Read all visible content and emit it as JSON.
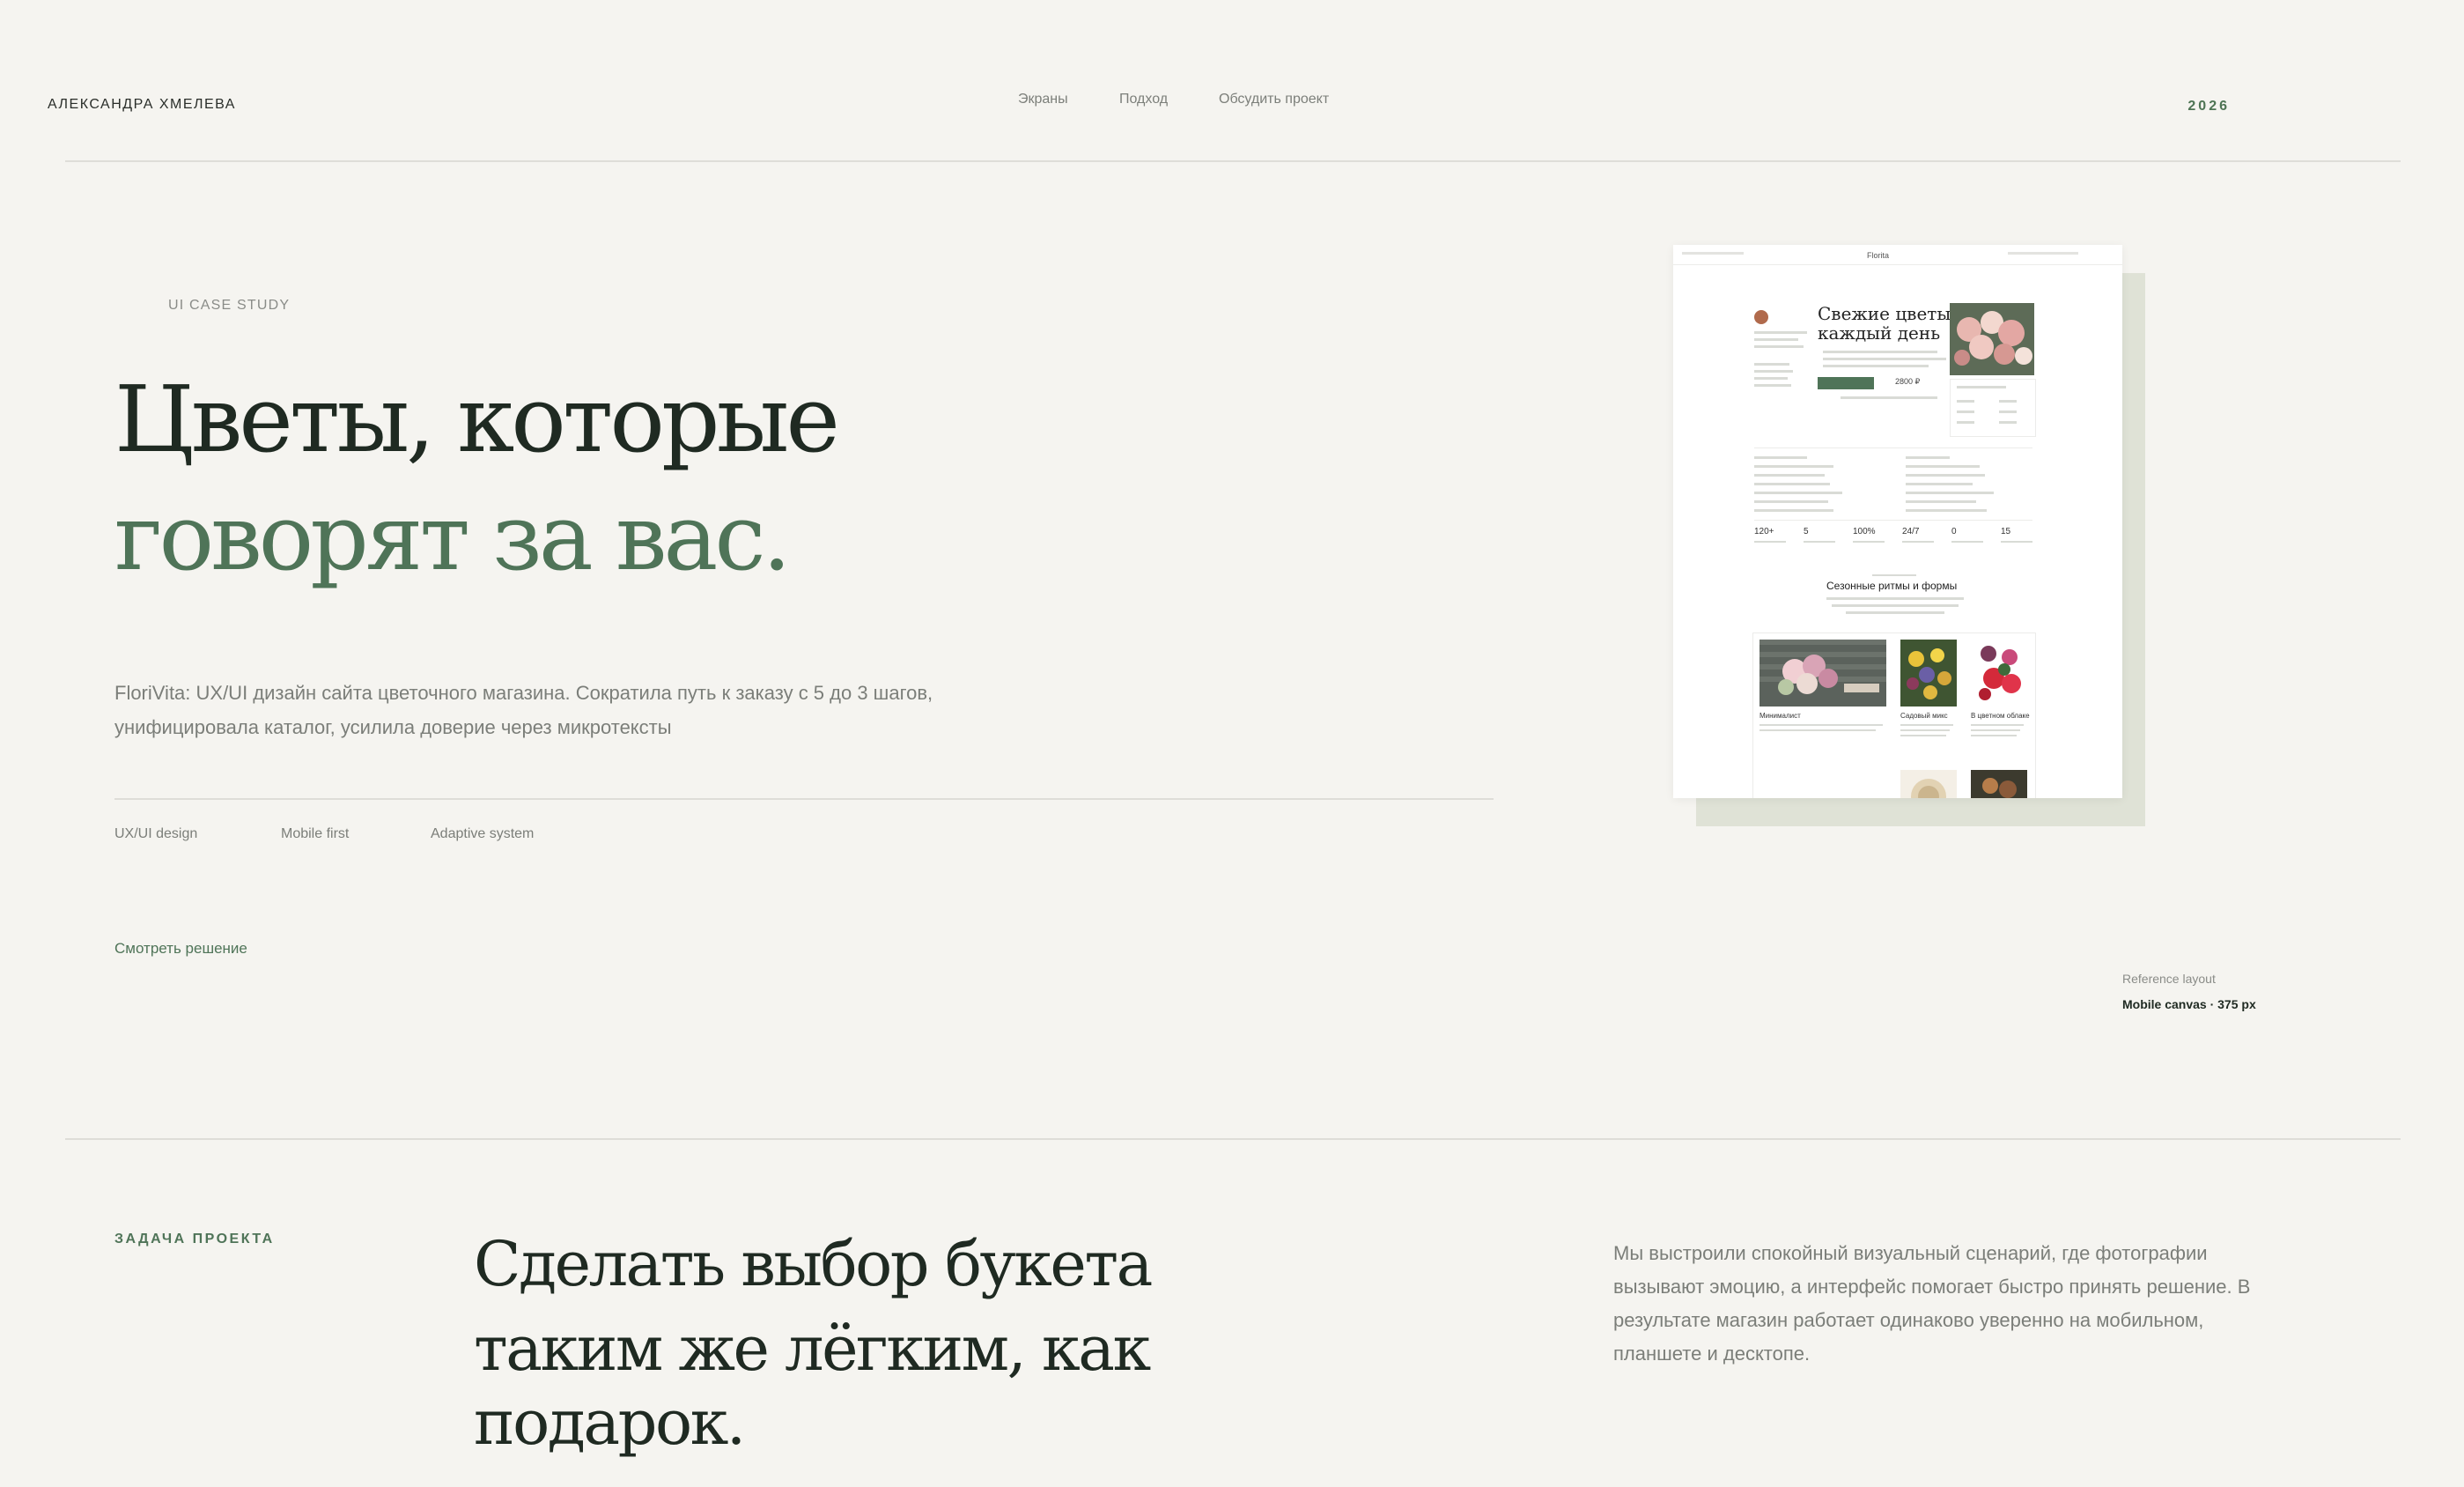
{
  "header": {
    "brand": "АЛЕКСАНДРА ХМЕЛЕВА",
    "nav": [
      "Экраны",
      "Подход",
      "Обсудить проект"
    ],
    "year": "2026"
  },
  "hero": {
    "eyebrow": "UI CASE STUDY",
    "title_line1": "Цветы, которые",
    "title_line2": "говорят за вас.",
    "description_line1": "FloriVita: UX/UI дизайн сайта цветочного магазина. Сократила путь к заказу с 5 до 3 шагов,",
    "description_line2": "унифицировала каталог, усилила доверие через микротексты",
    "tags": [
      "UX/UI design",
      "Mobile first",
      "Adaptive system"
    ],
    "cta": "Смотреть решение"
  },
  "mockup": {
    "logo": "Florita",
    "hero_title_line1": "Свежие цветы",
    "hero_title_line2": "каждый день",
    "price": "2800 ₽",
    "stats": [
      "120+",
      "5",
      "100%",
      "24/7",
      "0",
      "15"
    ],
    "section_title": "Сезонные ритмы и формы",
    "card1": "Минималист",
    "card2": "Садовый микс",
    "card3": "В цветном облаке"
  },
  "reference": {
    "label": "Reference layout",
    "value": "Mobile canvas · 375 px"
  },
  "task": {
    "label": "ЗАДАЧА ПРОЕКТА",
    "heading_line1": "Сделать выбор букета",
    "heading_line2": "таким же лёгким, как",
    "heading_line3": "подарок.",
    "paragraph_lines": [
      "Мы выстроили спокойный визуальный сценарий, где фотографии",
      "вызывают эмоцию, а интерфейс помогает быстро принять решение. В",
      "результате магазин работает одинаково уверенно на мобильном,",
      "планшете и десктопе."
    ]
  },
  "colors": {
    "background": "#f5f4f0",
    "accent": "#4f7458",
    "text_dark": "#1f2a22",
    "muted": "#7b7e79"
  }
}
